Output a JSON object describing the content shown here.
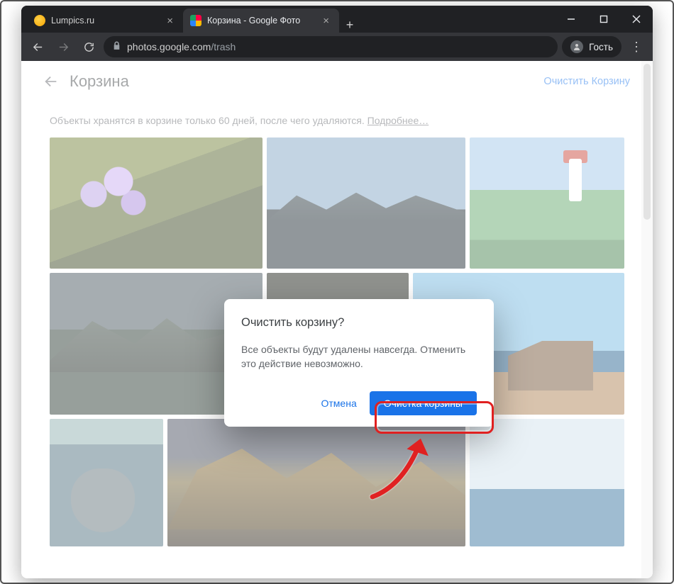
{
  "browser": {
    "tabs": [
      {
        "title": "Lumpics.ru"
      },
      {
        "title": "Корзина - Google Фото"
      }
    ],
    "url_display": "photos.google.com/trash",
    "url_host": "photos.google.com",
    "url_path": "/trash",
    "profile_label": "Гость"
  },
  "page": {
    "title": "Корзина",
    "empty_action": "Очистить Корзину",
    "info_text": "Объекты хранятся в корзине только 60 дней, после чего удаляются. ",
    "info_link": "Подробнее…"
  },
  "dialog": {
    "title": "Очистить корзину?",
    "body": "Все объекты будут удалены навсегда. Отменить это действие невозможно.",
    "cancel": "Отмена",
    "confirm": "Очистка корзины"
  }
}
